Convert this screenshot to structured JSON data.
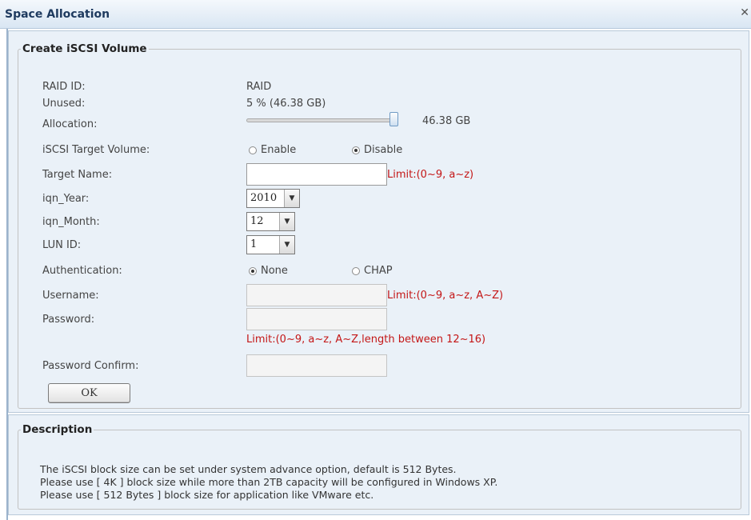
{
  "window": {
    "title": "Space Allocation",
    "close_glyph": "✕",
    "accent": "#1e3a5f"
  },
  "create": {
    "legend": "Create iSCSI Volume",
    "raid_id": {
      "label": "RAID ID:",
      "value": "RAID"
    },
    "unused": {
      "label": "Unused:",
      "value": "5 % (46.38 GB)"
    },
    "allocation": {
      "label": "Allocation:",
      "value": "46.38 GB",
      "slider_level_percent": 100
    },
    "target_volume": {
      "label": "iSCSI Target Volume:",
      "options": [
        {
          "label": "Enable",
          "checked": false
        },
        {
          "label": "Disable",
          "checked": true
        }
      ]
    },
    "target_name": {
      "label": "Target Name:",
      "value": "",
      "limit": "Limit:(0~9, a~z)"
    },
    "iqn_year": {
      "label": "iqn_Year:",
      "value": "2010"
    },
    "iqn_month": {
      "label": "iqn_Month:",
      "value": "12"
    },
    "lun_id": {
      "label": "LUN ID:",
      "value": "1"
    },
    "authentication": {
      "label": "Authentication:",
      "options": [
        {
          "label": "None",
          "checked": true
        },
        {
          "label": "CHAP",
          "checked": false
        }
      ]
    },
    "username": {
      "label": "Username:",
      "value": "",
      "limit": "Limit:(0~9, a~z, A~Z)"
    },
    "password": {
      "label": "Password:",
      "value": "",
      "limit": "Limit:(0~9, a~z, A~Z,length between 12~16)"
    },
    "password_confirm": {
      "label": "Password Confirm:",
      "value": ""
    },
    "ok_label": "OK",
    "limit_color": "#c41616"
  },
  "description": {
    "legend": "Description",
    "lines": [
      "The iSCSI block size can be set under system advance option, default is 512 Bytes.",
      "Please use [ 4K ] block size while more than 2TB capacity will be configured in Windows XP.",
      "Please use [ 512 Bytes ] block size for application like VMware etc."
    ]
  }
}
